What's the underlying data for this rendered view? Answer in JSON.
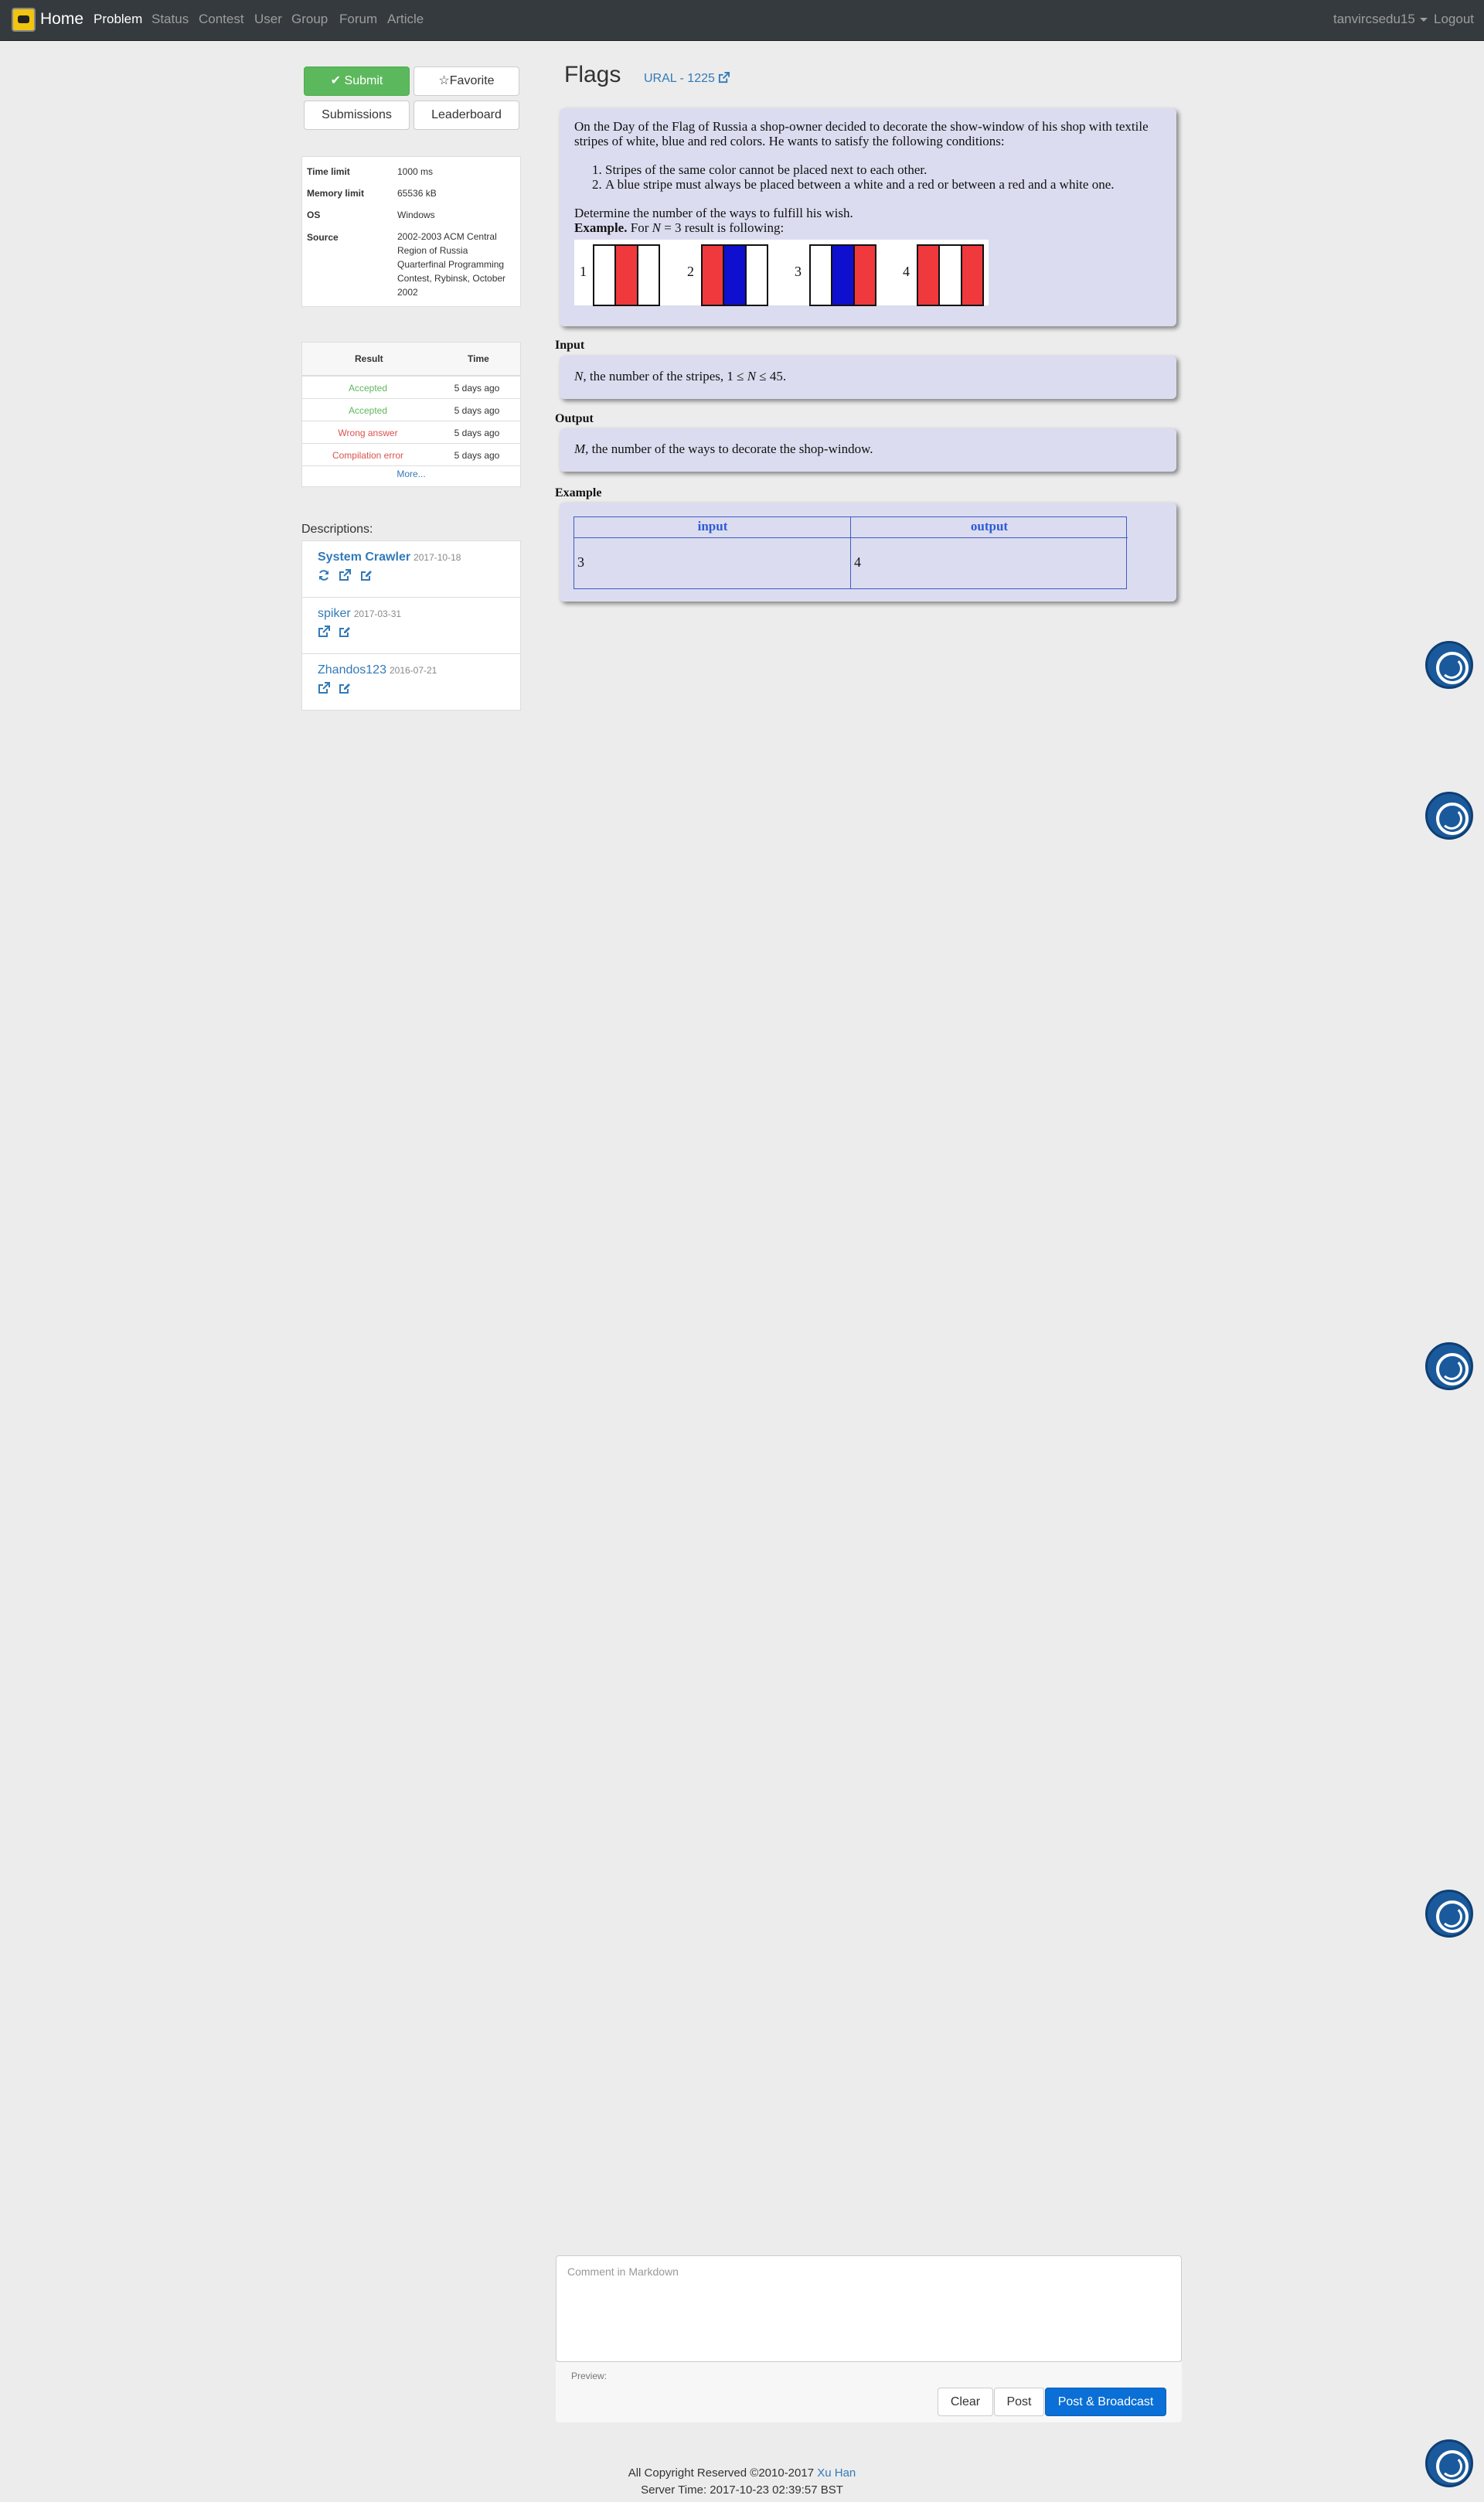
{
  "navbar": {
    "brand": "Home",
    "items": [
      "Problem",
      "Status",
      "Contest",
      "User",
      "Group",
      "Forum",
      "Article"
    ],
    "username": "tanvircsedu15",
    "logout": "Logout"
  },
  "actions": {
    "submit": "Submit",
    "favorite": "Favorite",
    "submissions": "Submissions",
    "leaderboard": "Leaderboard"
  },
  "problem_info": {
    "time_limit_label": "Time limit",
    "time_limit": "1000 ms",
    "memory_limit_label": "Memory limit",
    "memory_limit": "65536 kB",
    "os_label": "OS",
    "os": "Windows",
    "source_label": "Source",
    "source": "2002-2003 ACM Central Region of Russia Quarterfinal Programming Contest, Rybinsk, October 2002"
  },
  "status_table": {
    "headers": [
      "Result",
      "Time"
    ],
    "rows": [
      {
        "result": "Accepted",
        "time": "5 days ago",
        "state": "ok"
      },
      {
        "result": "Accepted",
        "time": "5 days ago",
        "state": "ok"
      },
      {
        "result": "Wrong answer",
        "time": "5 days ago",
        "state": "bad"
      },
      {
        "result": "Compilation error",
        "time": "5 days ago",
        "state": "bad"
      }
    ],
    "more": "More..."
  },
  "descriptions": {
    "label": "Descriptions:",
    "items": [
      {
        "author": "System Crawler",
        "date": "2017-10-18"
      },
      {
        "author": "spiker",
        "date": "2017-03-31"
      },
      {
        "author": "Zhandos123",
        "date": "2016-07-21"
      }
    ]
  },
  "problem": {
    "title": "Flags",
    "origin": "URAL - 1225",
    "statement": "On the Day of the Flag of Russia a shop-owner decided to decorate the show-window of his shop with textile stripes of white, blue and red colors. He wants to satisfy the following conditions:",
    "conditions": [
      "Stripes of the same color cannot be placed next to each other.",
      "A blue stripe must always be placed between a white and a red or between a red and a white one."
    ],
    "task": "Determine the number of the ways to fulfill his wish.",
    "example_bold": "Example.",
    "example_pre": "For",
    "example_var": "N",
    "example_post": "= 3 result is following:",
    "flags": [
      {
        "label": "1",
        "stripes": [
          "#ffffff",
          "#f0393c",
          "#ffffff"
        ]
      },
      {
        "label": "2",
        "stripes": [
          "#f0393c",
          "#0f0fcf",
          "#ffffff"
        ]
      },
      {
        "label": "3",
        "stripes": [
          "#ffffff",
          "#0f0fcf",
          "#f0393c"
        ]
      },
      {
        "label": "4",
        "stripes": [
          "#f0393c",
          "#ffffff",
          "#f0393c"
        ]
      }
    ],
    "input_label": "Input",
    "input_var": "N",
    "input_text": ", the number of the stripes, 1 ≤",
    "input_var2": "N",
    "input_text2": "≤ 45.",
    "output_label": "Output",
    "output_var": "M",
    "output_text": ", the number of the ways to decorate the shop-window.",
    "example_label": "Example",
    "example_headers": [
      "input",
      "output"
    ],
    "example_input": "3",
    "example_output": "4"
  },
  "comment": {
    "placeholder": "Comment in Markdown",
    "preview_label": "Preview:",
    "clear": "Clear",
    "post": "Post",
    "post_broadcast": "Post & Broadcast"
  },
  "footer": {
    "copyright": "All Copyright Reserved ©2010-2017",
    "author": "Xu Han",
    "server_time": "Server Time: 2017-10-23 02:39:57 BST"
  },
  "colors": {
    "accent": "#337ab7",
    "success": "#5cb85c",
    "danger": "#d9534f",
    "panel": "#dcdcf0",
    "primary_button": "#0a6fd6"
  }
}
